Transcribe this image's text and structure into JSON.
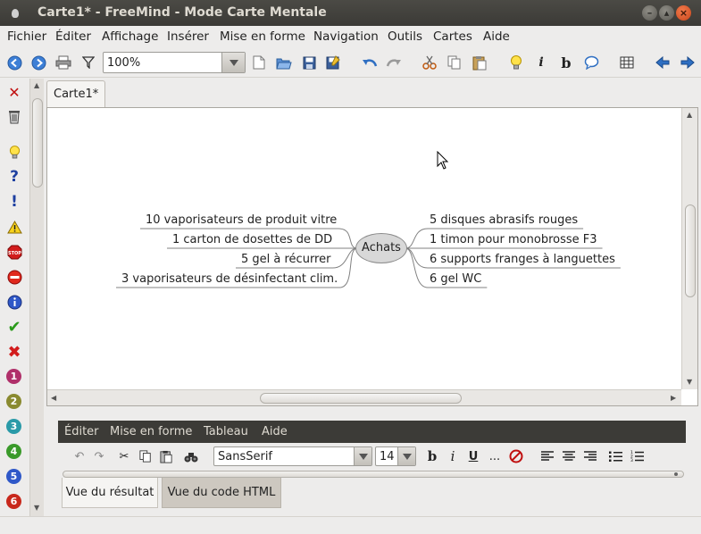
{
  "window": {
    "title": "Carte1* - FreeMind - Mode Carte Mentale"
  },
  "menu": {
    "items": [
      "Fichier",
      "Éditer",
      "Affichage",
      "Insérer",
      "Mise en forme",
      "Navigation",
      "Outils",
      "Cartes",
      "Aide"
    ]
  },
  "toolbar": {
    "zoom_value": "100%"
  },
  "tabs": {
    "active": "Carte1*"
  },
  "mindmap": {
    "root": "Achats",
    "left_nodes": [
      "10 vaporisateurs de produit vitre",
      "1 carton de dosettes de DD",
      "5 gel à récurrer",
      "3 vaporisateurs de désinfectant clim."
    ],
    "right_nodes": [
      "5 disques abrasifs rouges",
      "1 timon pour monobrosse F3",
      "6 supports franges à languettes",
      "6 gel WC"
    ],
    "node_bg": "#d8d8d8",
    "edge_color": "#808080"
  },
  "editor": {
    "menu": [
      "Éditer",
      "Mise en forme",
      "Tableau",
      "Aide"
    ],
    "font_family": "SansSerif",
    "font_size": "14",
    "bold_label": "b",
    "italic_label": "i",
    "underline_label": "U",
    "more_label": "...",
    "tabs": [
      "Vue du résultat",
      "Vue du code HTML"
    ]
  },
  "colors": {
    "titlebar": "#3c3b37",
    "accent_close": "#e05a27"
  }
}
